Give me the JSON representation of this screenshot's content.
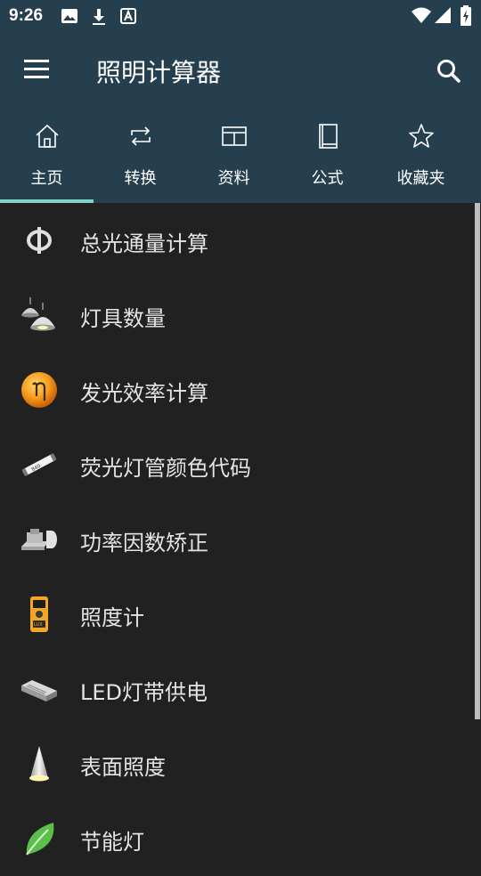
{
  "status": {
    "time": "9:26"
  },
  "app": {
    "title": "照明计算器"
  },
  "tabs": [
    {
      "label": "主页",
      "icon": "home-icon"
    },
    {
      "label": "转换",
      "icon": "repeat-icon"
    },
    {
      "label": "资料",
      "icon": "table-icon"
    },
    {
      "label": "公式",
      "icon": "book-icon"
    },
    {
      "label": "收藏夹",
      "icon": "star-icon"
    }
  ],
  "active_tab": "主页",
  "items": [
    {
      "label": "总光通量计算",
      "icon": "phi-icon"
    },
    {
      "label": "灯具数量",
      "icon": "pendant-lamps-icon"
    },
    {
      "label": "发光效率计算",
      "icon": "eta-icon"
    },
    {
      "label": "荧光灯管颜色代码",
      "icon": "fluorescent-tube-icon"
    },
    {
      "label": "功率因数矫正",
      "icon": "capacitor-icon"
    },
    {
      "label": "照度计",
      "icon": "lux-meter-icon"
    },
    {
      "label": "LED灯带供电",
      "icon": "led-power-supply-icon"
    },
    {
      "label": "表面照度",
      "icon": "light-cone-icon"
    },
    {
      "label": "节能灯",
      "icon": "leaf-icon"
    }
  ],
  "colors": {
    "appbar": "#263f4f",
    "background": "#212121",
    "indicator": "#7fd4c6"
  }
}
